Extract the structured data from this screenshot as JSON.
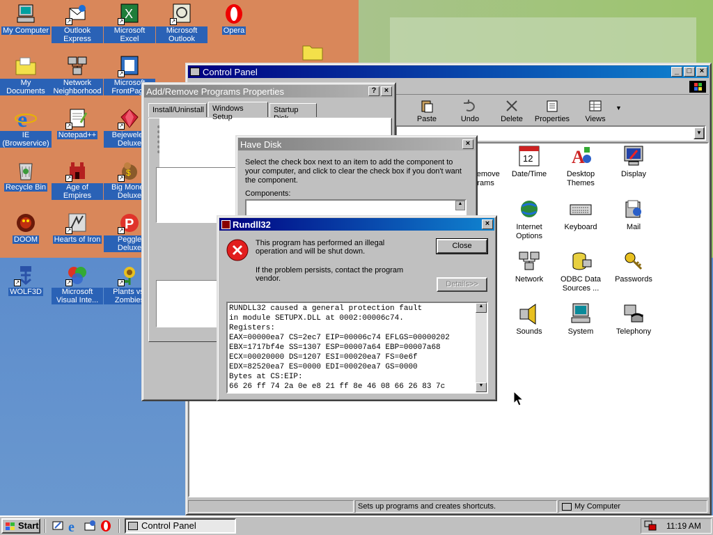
{
  "desktop": {
    "icons": [
      {
        "label": "My Computer",
        "icon": "computer-icon"
      },
      {
        "label": "Outlook Express",
        "icon": "outlook-express-icon"
      },
      {
        "label": "Microsoft Excel",
        "icon": "excel-icon"
      },
      {
        "label": "Microsoft Outlook",
        "icon": "outlook-icon"
      },
      {
        "label": "Opera",
        "icon": "opera-icon"
      },
      {
        "label": "My Documents",
        "icon": "documents-folder-icon"
      },
      {
        "label": "Network Neighborhood",
        "icon": "network-icon"
      },
      {
        "label": "Microsoft FrontPage",
        "icon": "frontpage-icon"
      },
      {
        "label": "IE (Browservice)",
        "icon": "ie-icon"
      },
      {
        "label": "Notepad++",
        "icon": "notepad-icon"
      },
      {
        "label": "Bejeweled Deluxe",
        "icon": "bejeweled-icon"
      },
      {
        "label": "Recycle Bin",
        "icon": "recycle-bin-icon"
      },
      {
        "label": "Age of Empires",
        "icon": "age-of-empires-icon"
      },
      {
        "label": "Big Money Deluxe",
        "icon": "big-money-icon"
      },
      {
        "label": "DOOM",
        "icon": "doom-icon"
      },
      {
        "label": "Hearts of Iron",
        "icon": "hearts-of-iron-icon"
      },
      {
        "label": "Peggle Deluxe",
        "icon": "peggle-icon"
      },
      {
        "label": "WOLF3D",
        "icon": "wolf3d-icon"
      },
      {
        "label": "Microsoft Visual Inte...",
        "icon": "visual-interdev-icon"
      },
      {
        "label": "Plants vs. Zombies",
        "icon": "plants-vs-zombies-icon"
      }
    ]
  },
  "control_panel": {
    "title": "Control Panel",
    "toolbar": {
      "paste": "Paste",
      "undo": "Undo",
      "delete": "Delete",
      "properties": "Properties",
      "views": "Views"
    },
    "items": [
      {
        "label": "Add/Remove Programs",
        "icon": "add-remove-icon"
      },
      {
        "label": "Date/Time",
        "icon": "calendar-icon"
      },
      {
        "label": "Desktop Themes",
        "icon": "themes-icon"
      },
      {
        "label": "Display",
        "icon": "display-icon"
      },
      {
        "label": "Internet Options",
        "icon": "internet-options-icon"
      },
      {
        "label": "Keyboard",
        "icon": "keyboard-icon"
      },
      {
        "label": "Mail",
        "icon": "mail-icon"
      },
      {
        "label": "Network",
        "icon": "network-icon"
      },
      {
        "label": "ODBC Data Sources ...",
        "icon": "odbc-icon"
      },
      {
        "label": "Passwords",
        "icon": "passwords-icon"
      },
      {
        "label": "Sounds",
        "icon": "sounds-icon"
      },
      {
        "label": "System",
        "icon": "system-icon"
      },
      {
        "label": "Telephony",
        "icon": "telephony-icon"
      }
    ],
    "status_left": "Sets up programs and creates shortcuts.",
    "status_right": "My Computer"
  },
  "addremove": {
    "title": "Add/Remove Programs Properties",
    "tabs": [
      "Install/Uninstall",
      "Windows Setup",
      "Startup Disk"
    ]
  },
  "have_disk": {
    "title": "Have Disk",
    "text": "Select the check box next to an item to add the component to your computer, and click to clear the check box if you don't want the component.",
    "components_label": "Components:"
  },
  "rundll": {
    "title": "Rundll32",
    "message1": "This program has performed an illegal operation and will be shut down.",
    "message2": "If the problem persists, contact the program vendor.",
    "close_label": "Close",
    "details_label": "Details>>",
    "details_lines": [
      "RUNDLL32 caused a general protection fault",
      "in module SETUPX.DLL at 0002:00006c74.",
      "Registers:",
      "EAX=00000ea7 CS=2ec7 EIP=00006c74 EFLGS=00000202",
      "EBX=1717bf4e SS=1307 ESP=00007a64 EBP=00007a68",
      "ECX=00020000 DS=1207 ESI=00020ea7 FS=0e6f",
      "EDX=82520ea7 ES=0000 EDI=00020ea7 GS=0000",
      "Bytes at CS:EIP:",
      "66 26 ff 74 2a 0e e8 21 ff 8e 46 08 66 26 83 7c"
    ]
  },
  "taskbar": {
    "start_label": "Start",
    "task_label": "Control Panel",
    "clock": "11:19 AM"
  }
}
